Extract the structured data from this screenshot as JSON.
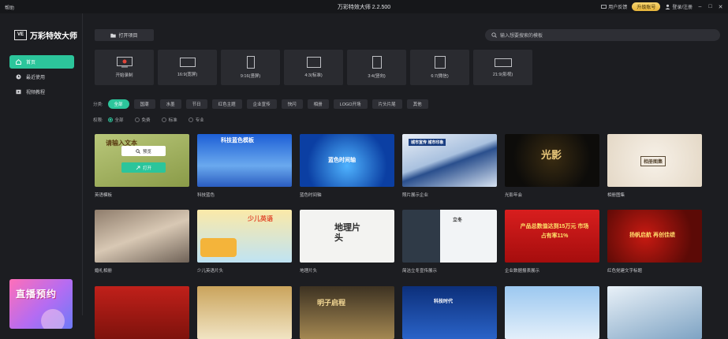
{
  "titlebar": {
    "help": "帮助",
    "title": "万彩特效大师 2.2.500",
    "feedback": "用户反馈",
    "upgrade": "升级账号",
    "login": "登录/注册",
    "minimize": "–",
    "maximize": "□",
    "close": "✕"
  },
  "sidebar": {
    "logo_mark": "VE",
    "logo_name": "万彩特效大师",
    "items": [
      {
        "label": "首页",
        "icon": "home-icon"
      },
      {
        "label": "最近使用",
        "icon": "clock-icon"
      },
      {
        "label": "视频教程",
        "icon": "video-icon"
      }
    ],
    "promo": "直播预约"
  },
  "toolbar": {
    "open_project": "打开项目",
    "search_placeholder": "输入想要搜索的模板"
  },
  "ratios": [
    {
      "label": "开始录制"
    },
    {
      "label": "16:9(宽屏)"
    },
    {
      "label": "9:16(竖屏)"
    },
    {
      "label": "4:3(标准)"
    },
    {
      "label": "3:4(竖向)"
    },
    {
      "label": "6:7(微信)"
    },
    {
      "label": "21:9(影视)"
    }
  ],
  "filters": {
    "category_label": "分类:",
    "categories": [
      "全部",
      "国潮",
      "水墨",
      "节日",
      "红色主题",
      "企业宣传",
      "快闪",
      "相册",
      "LOGO开场",
      "片头片尾",
      "其他"
    ],
    "permission_label": "权限:",
    "permissions": [
      "全部",
      "免费",
      "标准",
      "专业"
    ]
  },
  "overlay": {
    "preview": "预览",
    "open": "打开"
  },
  "cards": [
    {
      "name": "英语模板",
      "title": "请输入文本"
    },
    {
      "name": "科技蓝色",
      "title": "科技蓝色模板"
    },
    {
      "name": "蓝色时间轴",
      "title": "蓝色时间轴"
    },
    {
      "name": "照片展示企业",
      "title": "城市宣传 城市印象"
    },
    {
      "name": "光影年会",
      "title": "光影"
    },
    {
      "name": "相册图集",
      "title": "相册图集"
    },
    {
      "name": "婚礼相册",
      "title": ""
    },
    {
      "name": "少儿英语片头",
      "title": "少儿英语"
    },
    {
      "name": "地理片头",
      "title": "地理片头"
    },
    {
      "name": "简洁立冬宣传展示",
      "title": "立冬"
    },
    {
      "name": "企业数据报表展示",
      "title": "产品总数值达到15万元 市场占有率11%"
    },
    {
      "name": "红色党建文字标题",
      "title": "扬帆启航 再创佳绩"
    },
    {
      "name": "",
      "title": ""
    },
    {
      "name": "",
      "title": ""
    },
    {
      "name": "",
      "title": "明子启程"
    },
    {
      "name": "",
      "title": "科技时代"
    },
    {
      "name": "",
      "title": ""
    },
    {
      "name": "",
      "title": ""
    }
  ]
}
